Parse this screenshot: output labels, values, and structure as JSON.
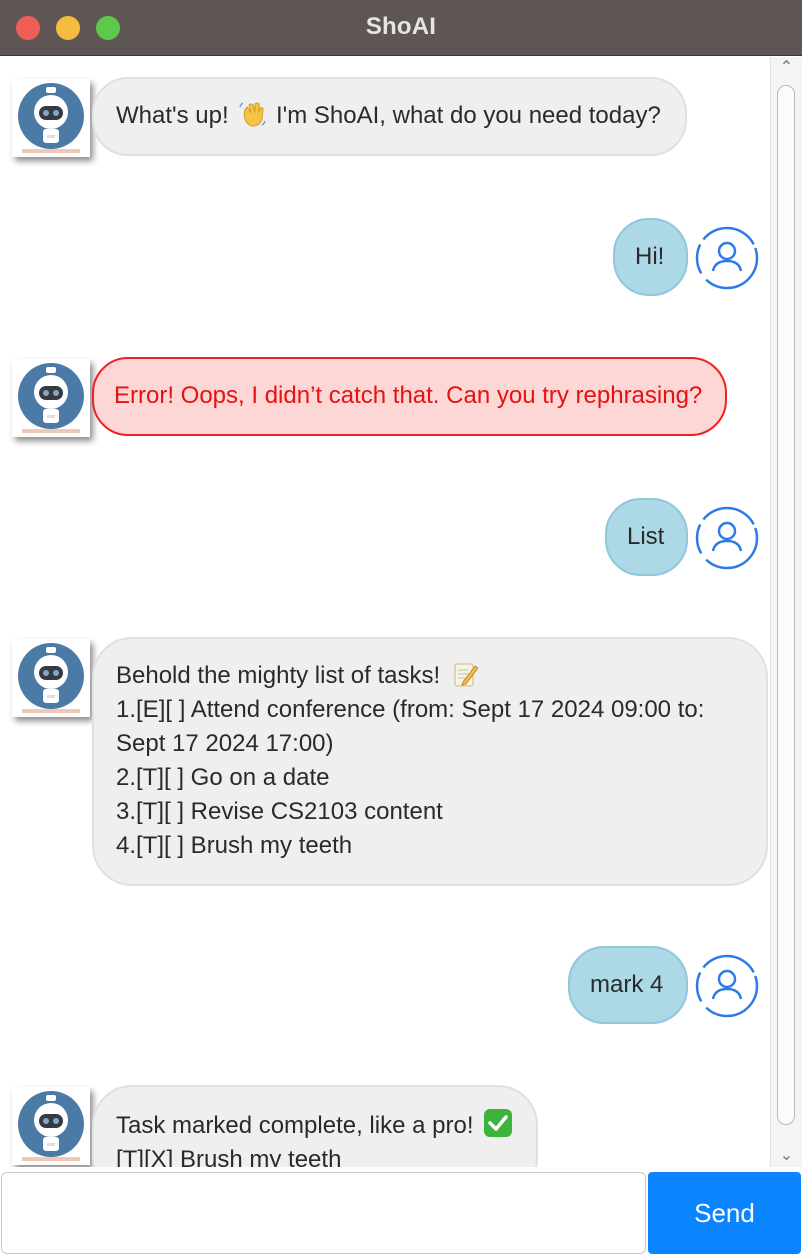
{
  "window": {
    "title": "ShoAI"
  },
  "colors": {
    "bot_bubble": "#efefef",
    "user_bubble": "#add8e6",
    "error_bubble": "#fdd6d6",
    "error_text": "#e51212",
    "send_button": "#0b84ff"
  },
  "messages": [
    {
      "from": "bot",
      "lines": [
        "What's up!",
        "I'm ShoAI, what do you need today?"
      ],
      "emoji": "waving-hand-icon"
    },
    {
      "from": "user",
      "text": "Hi!"
    },
    {
      "from": "bot",
      "kind": "error",
      "text": "Error! Oops, I didn’t catch that. Can you try rephrasing?"
    },
    {
      "from": "user",
      "text": "List"
    },
    {
      "from": "bot",
      "lines": [
        "Behold the mighty list of tasks!",
        "1.[E][ ] Attend conference (from: Sept 17 2024 09:00 to:",
        "Sept 17 2024 17:00)",
        "2.[T][ ] Go on a date",
        "3.[T][ ] Revise CS2103 content",
        "4.[T][ ] Brush my teeth"
      ],
      "emoji": "memo-icon"
    },
    {
      "from": "user",
      "text": "mark 4"
    },
    {
      "from": "bot",
      "lines": [
        "Task marked complete, like a pro!",
        "[T][X] Brush my teeth"
      ],
      "emoji": "check-mark-icon"
    }
  ],
  "input": {
    "value": "",
    "placeholder": ""
  },
  "send_label": "Send"
}
